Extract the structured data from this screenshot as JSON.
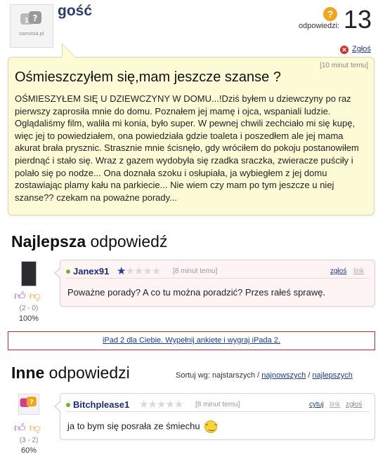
{
  "question": {
    "asker": "gość",
    "avatar_logo_text": "samosia.pl",
    "answers_label": "odpowiedzi:",
    "answers_count": "13",
    "report_label": "Zgłoś",
    "time": "[10 minut temu]",
    "title": "Ośmieszczyłem się,mam jeszcze szanse ?",
    "body": "OŚMIESZYŁEM SIĘ U DZIEWCZYNY W DOMU...!Dziś byłem u dziewczyny po raz pierwszy zaprosiła mnie do domu. Poznałem jej mamę i ojca, wspaniali ludzie. Oglądaliśmy film, waliła mi konia, było super. W pewnej chwili zechciało mi się kupę, więc jej to powiedziałem, ona powiedziała gdzie toaleta i poszedłem ale jej mama akurat brała prysznic. Strasznie mnie ścisnęło, gdy wróciłem do pokoju postanowiłem pierdnąć i stało się. Wraz z gazem wydobyła się rzadka sraczka, zwieracze puściły i polało się po nodze... Ona doznała szoku i osłupiała, ja wybiegłem z jej domu zostawiając plamy kału na parkiecie... Nie wiem czy mam po tym jeszcze u niej szanse?? czekam na poważne porady..."
  },
  "best": {
    "heading_bold": "Najlepsza",
    "heading_rest": " odpowiedź",
    "user": "Janex91",
    "stars_on": 1,
    "stars_total": 5,
    "time": "[8 minut temu]",
    "report": "zgłoś",
    "link": "link",
    "text": "Poważne porady? A co tu można poradzić? Przes rałeś sprawę.",
    "score": "(2 - 0)",
    "percent": "100%"
  },
  "promo": "iPad 2 dla Ciebie. Wypełnij ankiete i wygraj iPada 2.",
  "others": {
    "heading_bold": "Inne",
    "heading_rest": " odpowiedzi",
    "sort_label": "Sortuj wg: najstarszych / ",
    "sort_newest": "najnowszych",
    "sort_sep": " / ",
    "sort_best": "najlepszych",
    "answers": [
      {
        "user": "Bitchplease1",
        "stars_on": 0,
        "stars_total": 5,
        "time": "[8 minut temu]",
        "quote": "cytuj",
        "link": "link",
        "report": "zgłoś",
        "text": "ja to bym się posrała ze śmiechu",
        "score": "(3 - 2)",
        "percent": "60%"
      }
    ]
  },
  "icons": {
    "thumb_up": "thumb-up-icon",
    "thumb_down": "thumb-down-icon",
    "question_mark": "question-mark-icon",
    "report_x": "report-x-icon",
    "laughing_emoji": "laughing-emoji-icon"
  },
  "colors": {
    "question_bg": "#fdfbd6",
    "best_answer_bg": "#fff4f4",
    "link": "#1a3a8f",
    "username": "#1b2d7a",
    "promo_border": "#c72c2c",
    "online_dot": "#6fb52f"
  }
}
